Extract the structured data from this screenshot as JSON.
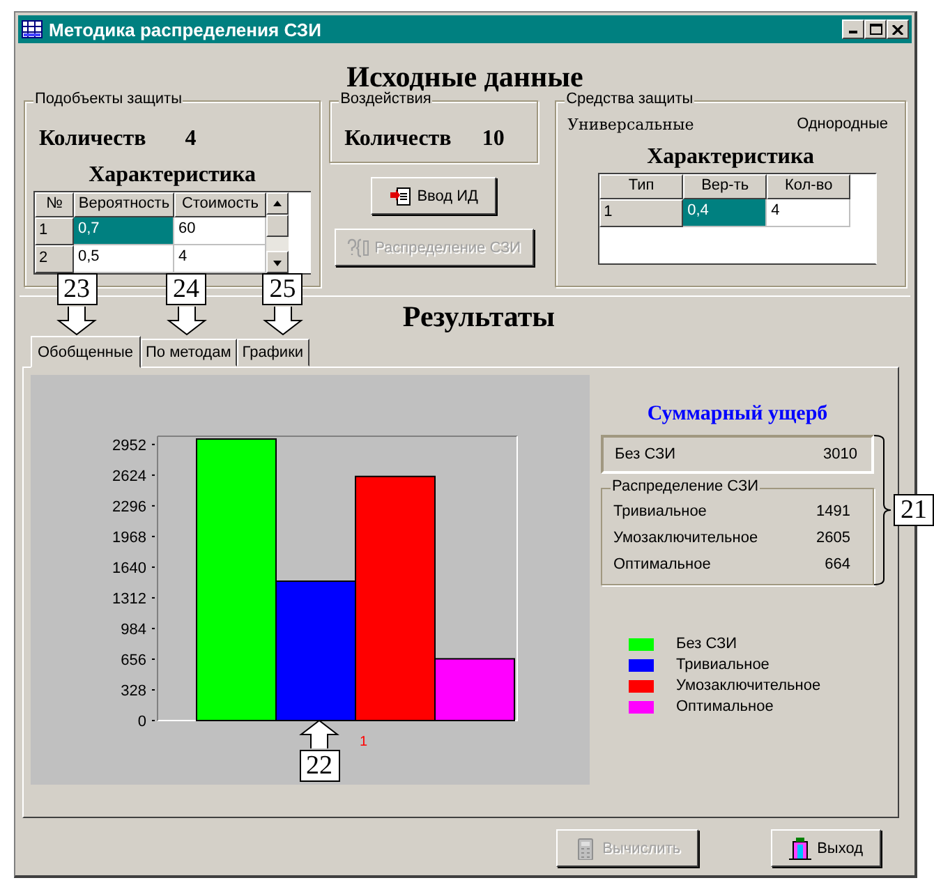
{
  "window": {
    "title": "Методика распределения СЗИ"
  },
  "source": {
    "heading": "Исходные данные",
    "subobjects": {
      "legend": "Подобъекты защиты",
      "count_label": "Количеств",
      "count": "4",
      "table_title": "Характеристика",
      "columns": [
        "№",
        "Вероятность",
        "Стоимость"
      ],
      "rows": [
        {
          "cells": [
            {
              "text": "1",
              "selected": false
            },
            {
              "text": "0,7",
              "selected": true
            },
            {
              "text": "60",
              "selected": false
            }
          ]
        },
        {
          "cells": [
            {
              "text": "2",
              "selected": false
            },
            {
              "text": "0,5",
              "selected": false
            },
            {
              "text": "4",
              "selected": false
            }
          ]
        }
      ]
    },
    "impacts": {
      "legend": "Воздействия",
      "count_label": "Количеств",
      "count": "10"
    },
    "buttons": [
      {
        "label": "Ввод ИД",
        "kind": "input",
        "disabled": false
      },
      {
        "label": "Распределение СЗИ",
        "kind": "distribute",
        "disabled": true
      }
    ],
    "means": {
      "legend": "Средства защиты",
      "options": [
        "Универсальные",
        "Однородные"
      ],
      "table_title": "Характеристика",
      "columns": [
        "Тип",
        "Вер-ть",
        "Кол-во"
      ],
      "rows": [
        {
          "cells": [
            {
              "text": "1",
              "selected": false
            },
            {
              "text": "0,4",
              "selected": true
            },
            {
              "text": "4",
              "selected": false
            }
          ]
        }
      ]
    }
  },
  "results": {
    "heading": "Результаты",
    "tabs": [
      {
        "label": "Обобщенные",
        "selected": true,
        "callout": "23"
      },
      {
        "label": "По методам",
        "selected": false,
        "callout": "24"
      },
      {
        "label": "Графики",
        "selected": false,
        "callout": "25"
      }
    ],
    "chart_data": {
      "type": "bar",
      "categories": [
        "1"
      ],
      "ylim": [
        0,
        3040
      ],
      "yticks": [
        0,
        328,
        656,
        984,
        1312,
        1640,
        1968,
        2296,
        2624,
        2952
      ],
      "series": [
        {
          "name": "Без СЗИ",
          "color": "#00ff00",
          "values": [
            3010
          ]
        },
        {
          "name": "Тривиальное",
          "color": "#0000ff",
          "values": [
            1490
          ]
        },
        {
          "name": "Умозаключительное",
          "color": "#ff0000",
          "values": [
            2610
          ]
        },
        {
          "name": "Оптимальное",
          "color": "#ff00ff",
          "values": [
            660
          ]
        }
      ]
    },
    "chart_callout": "22",
    "summary": {
      "title": "Суммарный ущерб",
      "total": {
        "label": "Без СЗИ",
        "value": "3010"
      },
      "distribution": {
        "legend": "Распределение СЗИ",
        "items": [
          {
            "label": "Тривиальное",
            "value": "1491"
          },
          {
            "label": "Умозаключительное",
            "value": "2605"
          },
          {
            "label": "Оптимальное",
            "value": "664"
          }
        ]
      },
      "callout": "21"
    }
  },
  "footer_buttons": [
    {
      "label": "Вычислить",
      "kind": "calc",
      "disabled": true
    },
    {
      "label": "Выход",
      "kind": "exit",
      "disabled": false
    }
  ]
}
